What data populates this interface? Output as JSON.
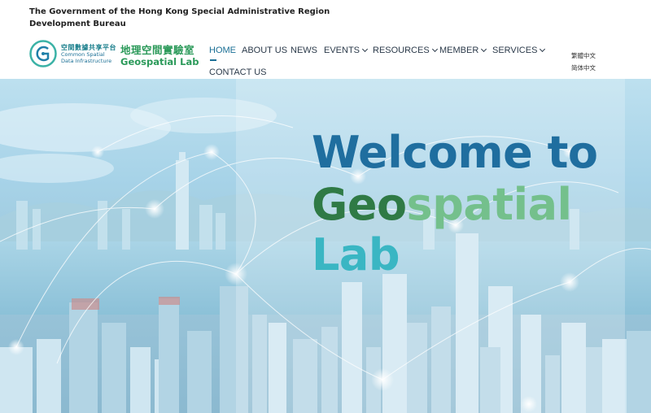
{
  "header": {
    "gov_title": "The Government of the Hong Kong Special Administrative Region",
    "bureau": "Development Bureau"
  },
  "logos": {
    "csdi_zh": "空間數據共享平台",
    "csdi_en_line1": "Common Spatial",
    "csdi_en_line2": "Data Infrastructure",
    "lab_zh": "地理空間實驗室",
    "lab_en": "Geospatial Lab"
  },
  "nav": {
    "items": [
      {
        "label": "HOME",
        "dropdown": false,
        "active": true
      },
      {
        "label": "ABOUT US",
        "dropdown": false
      },
      {
        "label": "NEWS",
        "dropdown": false
      },
      {
        "label": "EVENTS",
        "dropdown": true
      },
      {
        "label": "RESOURCES",
        "dropdown": true
      },
      {
        "label": "MEMBER",
        "dropdown": true
      },
      {
        "label": "SERVICES",
        "dropdown": true
      },
      {
        "label": "CONTACT US",
        "dropdown": false
      }
    ]
  },
  "language": {
    "traditional": "繁體中文",
    "simplified": "简体中文"
  },
  "hero": {
    "line1": "Welcome to",
    "line2_a": "Geo",
    "line2_b": "spatial",
    "line3": "Lab"
  },
  "colors": {
    "brand_blue": "#1f6e9f",
    "brand_green": "#2f7a45",
    "light_green": "#74c08c",
    "teal": "#3ab6c3"
  }
}
